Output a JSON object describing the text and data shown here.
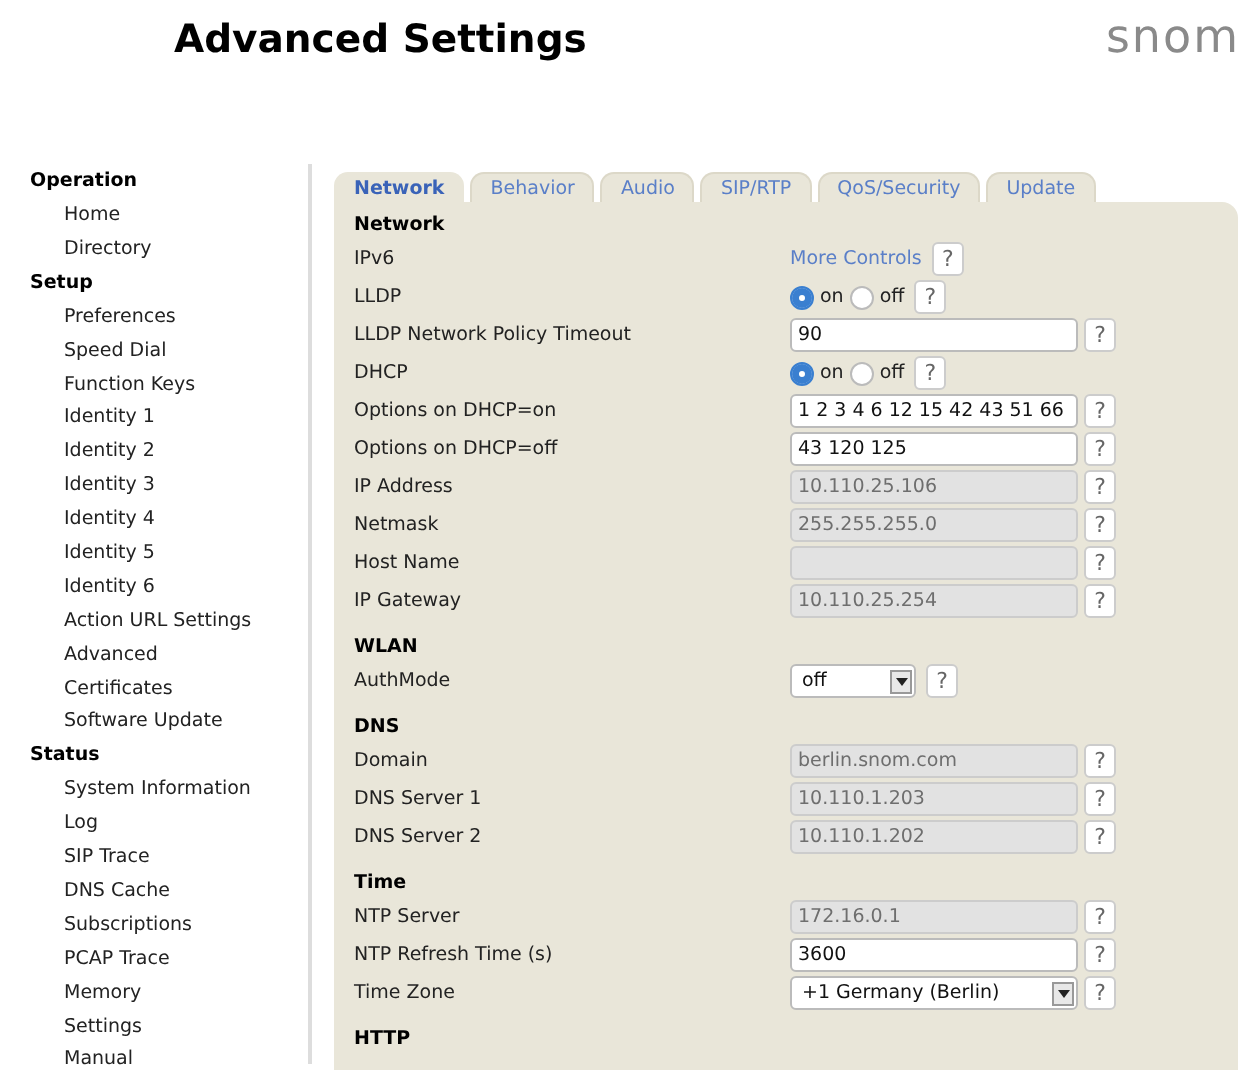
{
  "header": {
    "title": "Advanced Settings",
    "logo": "snom"
  },
  "sidebar": [
    {
      "heading": "Operation",
      "items": [
        "Home",
        "Directory"
      ]
    },
    {
      "heading": "Setup",
      "items": [
        "Preferences",
        "Speed Dial",
        "Function Keys",
        "Identity 1",
        "Identity 2",
        "Identity 3",
        "Identity 4",
        "Identity 5",
        "Identity 6",
        "Action URL Settings",
        "Advanced",
        "Certificates",
        "Software Update"
      ]
    },
    {
      "heading": "Status",
      "items": [
        "System Information",
        "Log",
        "SIP Trace",
        "DNS Cache",
        "Subscriptions",
        "PCAP Trace",
        "Memory",
        "Settings",
        "Manual"
      ]
    }
  ],
  "tabs": [
    {
      "label": "Network",
      "selected": true
    },
    {
      "label": "Behavior",
      "selected": false
    },
    {
      "label": "Audio",
      "selected": false
    },
    {
      "label": "SIP/RTP",
      "selected": false
    },
    {
      "label": "QoS/Security",
      "selected": false
    },
    {
      "label": "Update",
      "selected": false
    }
  ],
  "sections": [
    {
      "heading": "Network",
      "rows": [
        {
          "label": "IPv6",
          "kind": "link",
          "link": "More Controls",
          "help": "?"
        },
        {
          "label": "LLDP",
          "kind": "radio",
          "options": [
            {
              "label": "on",
              "selected": true
            },
            {
              "label": "off",
              "selected": false
            }
          ],
          "help": "?"
        },
        {
          "label": "LLDP Network Policy Timeout",
          "kind": "text",
          "value": "90",
          "disabled": false,
          "help": "?"
        },
        {
          "label": "DHCP",
          "kind": "radio",
          "options": [
            {
              "label": "on",
              "selected": true
            },
            {
              "label": "off",
              "selected": false
            }
          ],
          "help": "?"
        },
        {
          "label": "Options on DHCP=on",
          "kind": "text",
          "value": "1 2 3 4 6 12 15 42 43 51 66",
          "disabled": false,
          "help": "?"
        },
        {
          "label": "Options on DHCP=off",
          "kind": "text",
          "value": "43 120 125",
          "disabled": false,
          "help": "?"
        },
        {
          "label": "IP Address",
          "kind": "text",
          "value": "10.110.25.106",
          "disabled": true,
          "help": "?"
        },
        {
          "label": "Netmask",
          "kind": "text",
          "value": "255.255.255.0",
          "disabled": true,
          "help": "?"
        },
        {
          "label": "Host Name",
          "kind": "text",
          "disabled": true,
          "help": "?"
        },
        {
          "label": "IP Gateway",
          "kind": "text",
          "value": "10.110.25.254",
          "disabled": true,
          "help": "?"
        }
      ]
    },
    {
      "heading": "WLAN",
      "rows": [
        {
          "label": "AuthMode",
          "kind": "short-select",
          "value": "off",
          "help": "?"
        }
      ]
    },
    {
      "heading": "DNS",
      "rows": [
        {
          "label": "Domain",
          "kind": "text",
          "value": "berlin.snom.com",
          "disabled": true,
          "help": "?"
        },
        {
          "label": "DNS Server 1",
          "kind": "text",
          "value": "10.110.1.203",
          "disabled": true,
          "help": "?"
        },
        {
          "label": "DNS Server 2",
          "kind": "text",
          "value": "10.110.1.202",
          "disabled": true,
          "help": "?"
        }
      ]
    },
    {
      "heading": "Time",
      "rows": [
        {
          "label": "NTP Server",
          "kind": "text",
          "value": "172.16.0.1",
          "disabled": true,
          "help": "?"
        },
        {
          "label": "NTP Refresh Time (s)",
          "kind": "text",
          "value": "3600",
          "disabled": false,
          "help": "?"
        },
        {
          "label": "Time Zone",
          "kind": "select",
          "value": "+1 Germany (Berlin)",
          "help": "?"
        }
      ]
    },
    {
      "heading": "HTTP"
    }
  ]
}
